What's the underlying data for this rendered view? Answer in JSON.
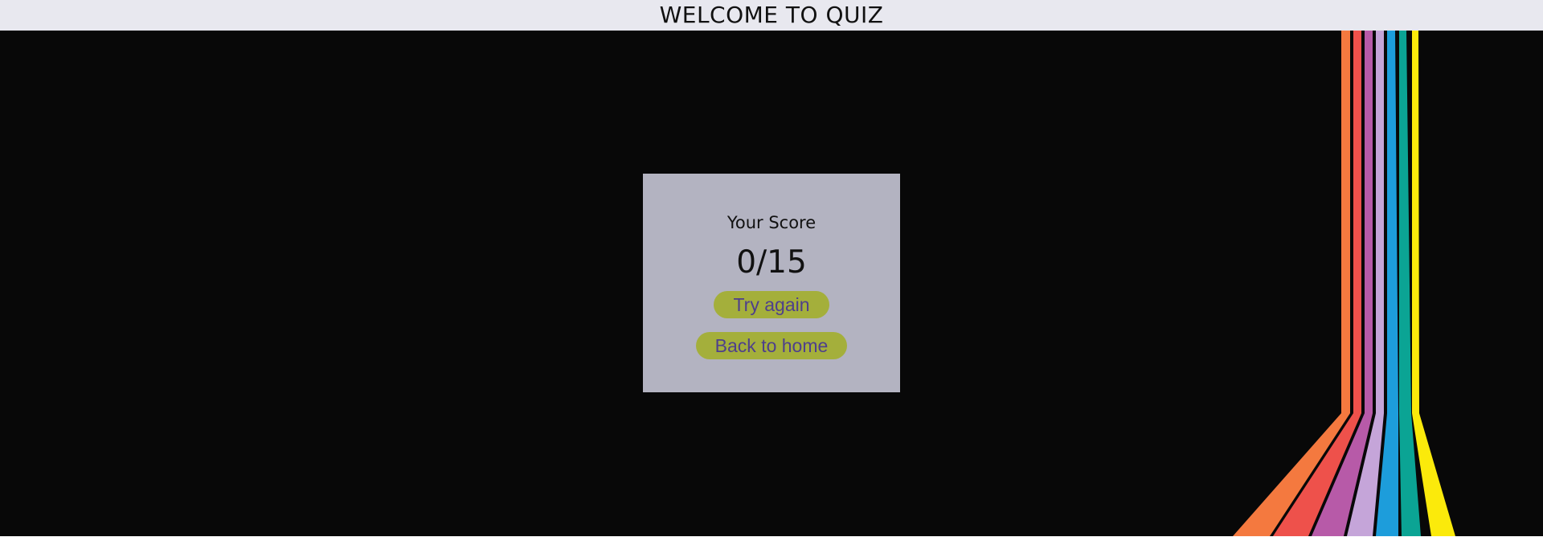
{
  "header": {
    "title": "WELCOME TO QUIZ"
  },
  "result": {
    "label": "Your Score",
    "score": "0/15",
    "try_again_label": "Try again",
    "back_home_label": "Back to home"
  },
  "colors": {
    "header_bg": "#e8e8ef",
    "stage_bg": "#080808",
    "card_bg": "#b3b3c1",
    "button_bg": "#a4af3b",
    "button_text": "#4e3f8c",
    "stripes": [
      "#f4793f",
      "#ee514b",
      "#b75aa8",
      "#c5a5d9",
      "#1d9ddb",
      "#0ba494",
      "#fbea0b"
    ]
  }
}
